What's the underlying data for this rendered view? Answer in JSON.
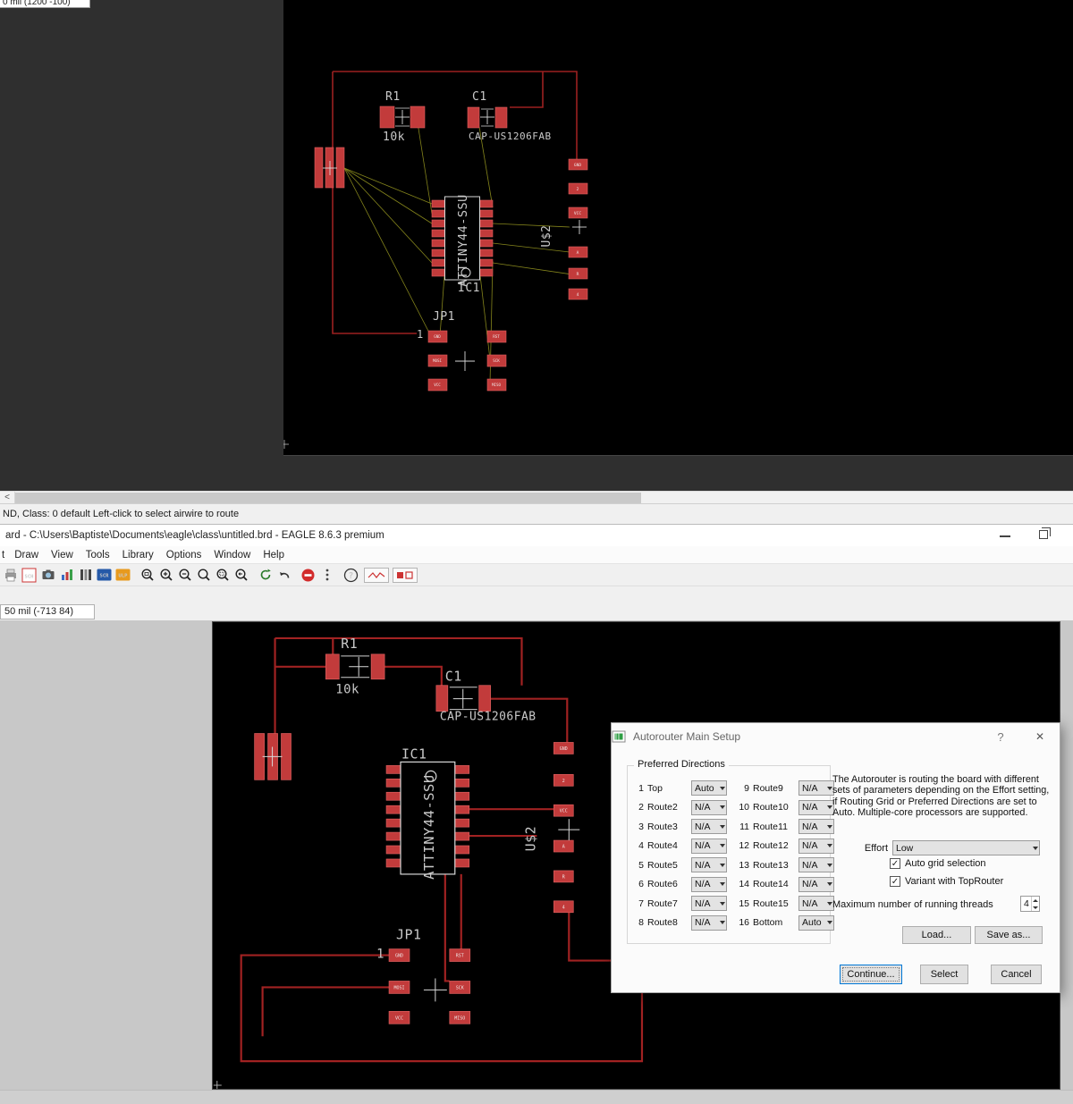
{
  "top_window": {
    "coord_fragment": "0 mil (1200 -100)",
    "scroll_left_glyph": "<",
    "status": "ND, Class: 0 default Left-click to select airwire to route"
  },
  "window": {
    "title": "ard - C:\\Users\\Baptiste\\Documents\\eagle\\class\\untitled.brd - EAGLE 8.6.3 premium"
  },
  "menu": {
    "items": [
      "t",
      "Draw",
      "View",
      "Tools",
      "Library",
      "Options",
      "Window",
      "Help"
    ]
  },
  "toolbar": {
    "sch": "SCH",
    "scr": "SCR",
    "ulp": "ULP",
    "help": "?"
  },
  "bottom_window": {
    "coord": "50 mil (-713 84)"
  },
  "pcb": {
    "r1_name": "R1",
    "r1_value": "10k",
    "c1_name": "C1",
    "c1_value": "CAP-US1206FAB",
    "ic1_name": "IC1",
    "ic1_value": "ATTINY44-SSU",
    "u2_name": "U$2",
    "jp1_name": "JP1",
    "jp1_pin1": "1",
    "jp1_pads": [
      "GND",
      "RST",
      "MOSI",
      "SCK",
      "VCC",
      "MISO"
    ],
    "conn_pads": [
      "GND",
      "2",
      "VCC",
      "A",
      "R",
      "4"
    ]
  },
  "dialog": {
    "title": "Autorouter Main Setup",
    "help_glyph": "?",
    "close_glyph": "✕",
    "group": "Preferred Directions",
    "rows": [
      {
        "n1": "1",
        "l1": "Top",
        "v1": "Auto",
        "n2": "9",
        "l2": "Route9",
        "v2": "N/A"
      },
      {
        "n1": "2",
        "l1": "Route2",
        "v1": "N/A",
        "n2": "10",
        "l2": "Route10",
        "v2": "N/A"
      },
      {
        "n1": "3",
        "l1": "Route3",
        "v1": "N/A",
        "n2": "11",
        "l2": "Route11",
        "v2": "N/A"
      },
      {
        "n1": "4",
        "l1": "Route4",
        "v1": "N/A",
        "n2": "12",
        "l2": "Route12",
        "v2": "N/A"
      },
      {
        "n1": "5",
        "l1": "Route5",
        "v1": "N/A",
        "n2": "13",
        "l2": "Route13",
        "v2": "N/A"
      },
      {
        "n1": "6",
        "l1": "Route6",
        "v1": "N/A",
        "n2": "14",
        "l2": "Route14",
        "v2": "N/A"
      },
      {
        "n1": "7",
        "l1": "Route7",
        "v1": "N/A",
        "n2": "15",
        "l2": "Route15",
        "v2": "N/A"
      },
      {
        "n1": "8",
        "l1": "Route8",
        "v1": "N/A",
        "n2": "16",
        "l2": "Bottom",
        "v2": "Auto"
      }
    ],
    "info": "The Autorouter is routing the board with different sets of parameters depending on the Effort setting, if Routing Grid or Preferred Directions are set to Auto. Multiple-core processors are supported.",
    "effort_label": "Effort",
    "effort_value": "Low",
    "check_glyph": "✓",
    "check1": "Auto grid selection",
    "check2": "Variant with TopRouter",
    "threads_label": "Maximum number of running threads",
    "threads_value": "4",
    "load": "Load...",
    "save_as": "Save as...",
    "continue": "Continue...",
    "select": "Select",
    "cancel": "Cancel"
  }
}
